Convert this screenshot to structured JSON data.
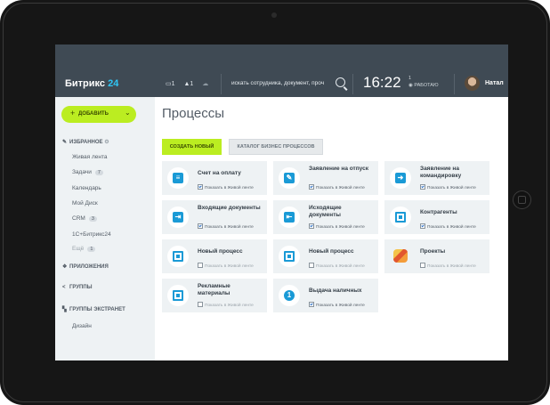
{
  "app": {
    "logo_text": "Битрикс",
    "logo_num": "24"
  },
  "topbar": {
    "messages_count": "1",
    "notifications_count": "1",
    "search_placeholder": "искать сотрудника, документ, проч",
    "time": "16:22",
    "clock_flag": "1",
    "status": "РАБОТАЮ",
    "user_name": "Натал"
  },
  "sidebar": {
    "add_button": "ДОБАВИТЬ",
    "favorites": "ИЗБРАННОЕ",
    "items": [
      {
        "label": "Живая лента",
        "badge": ""
      },
      {
        "label": "Задачи",
        "badge": "7"
      },
      {
        "label": "Календарь",
        "badge": ""
      },
      {
        "label": "Мой Диск",
        "badge": ""
      },
      {
        "label": "CRM",
        "badge": "3"
      },
      {
        "label": "1С+Битрикс24",
        "badge": ""
      },
      {
        "label": "Ещё",
        "badge": "1"
      }
    ],
    "apps": "ПРИЛОЖЕНИЯ",
    "groups": "ГРУППЫ",
    "extranet": "ГРУППЫ ЭКСТРАНЕТ",
    "design": "Дизайн"
  },
  "main": {
    "title": "Процессы",
    "create_button": "СОЗДАТЬ НОВЫЙ",
    "catalog_button": "КАТАЛОГ БИЗНЕС ПРОЦЕССОВ",
    "show_label": "Показать в Живой ленте",
    "cards": [
      {
        "title": "Счет на оплату",
        "checked": true,
        "icon": "invoice-icon"
      },
      {
        "title": "Заявление на отпуск",
        "checked": true,
        "icon": "edit-icon"
      },
      {
        "title": "Заявление на командировку",
        "checked": true,
        "icon": "arrow-right-icon"
      },
      {
        "title": "Входящие документы",
        "checked": true,
        "icon": "incoming-doc-icon"
      },
      {
        "title": "Исходящие документы",
        "checked": true,
        "icon": "outgoing-doc-icon"
      },
      {
        "title": "Контрагенты",
        "checked": true,
        "icon": "contractors-icon"
      },
      {
        "title": "Новый процесс",
        "checked": false,
        "icon": "process-icon"
      },
      {
        "title": "Новый процесс",
        "checked": false,
        "icon": "process-icon"
      },
      {
        "title": "Проекты",
        "checked": false,
        "icon": "projects-icon"
      },
      {
        "title": "Рекламные материалы",
        "checked": false,
        "icon": "process-icon"
      },
      {
        "title": "Выдача наличных",
        "checked": true,
        "icon": "cash-icon"
      }
    ]
  }
}
